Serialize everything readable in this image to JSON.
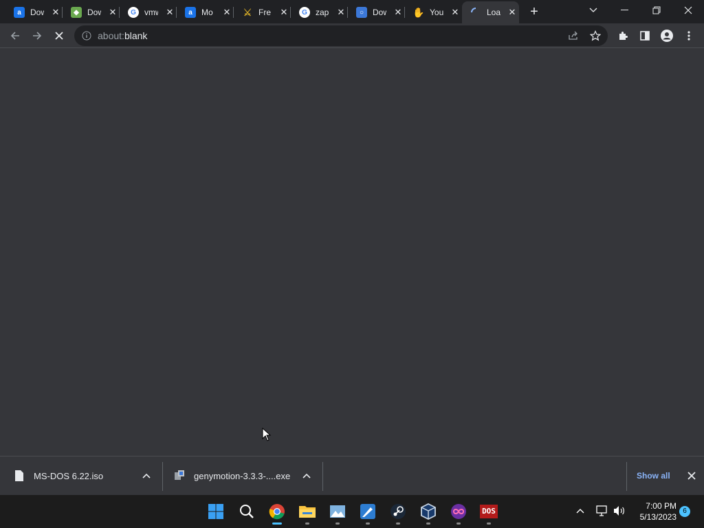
{
  "browser": {
    "tabs": [
      {
        "title": "Dow",
        "favicon": "blue-square-logo-icon",
        "color": "#1a73e8"
      },
      {
        "title": "Dow",
        "favicon": "bluestacks-icon",
        "color": "#6aa84f"
      },
      {
        "title": "vmw",
        "favicon": "google-icon",
        "color": "#ffffff"
      },
      {
        "title": "Mo",
        "favicon": "blue-square-logo-icon",
        "color": "#1a73e8"
      },
      {
        "title": "Fre",
        "favicon": "sword-icon",
        "color": "#c9a227"
      },
      {
        "title": "zap",
        "favicon": "google-icon",
        "color": "#ffffff"
      },
      {
        "title": "Dow",
        "favicon": "magnifier-site-icon",
        "color": "#3c78d8"
      },
      {
        "title": "You",
        "favicon": "red-hand-icon",
        "color": "#e02020"
      },
      {
        "title": "Loa",
        "favicon": "loading-spinner-icon",
        "color": "#8ab4f8",
        "active": true
      }
    ],
    "new_tab_symbol": "+",
    "address": {
      "prefix": "about:",
      "rest": "blank"
    }
  },
  "downloads": [
    {
      "name": "MS-DOS 6.22.iso",
      "icon": "file-icon"
    },
    {
      "name": "genymotion-3.3.3-....exe",
      "icon": "installer-icon"
    }
  ],
  "shelf": {
    "show_all_label": "Show all"
  },
  "taskbar": {
    "apps": [
      "windows-start-icon",
      "search-icon",
      "chrome-icon",
      "file-explorer-icon",
      "photos-icon",
      "paint-icon",
      "steam-icon",
      "virtualbox-icon",
      "app-infinity-icon",
      "dosbox-icon"
    ],
    "time": "7:00 PM",
    "date": "5/13/2023",
    "notification_count": "6",
    "dos_label": "DOS"
  },
  "colors": {
    "accent": "#8ab4f8",
    "background": "#35363a",
    "tabstrip": "#202124"
  }
}
